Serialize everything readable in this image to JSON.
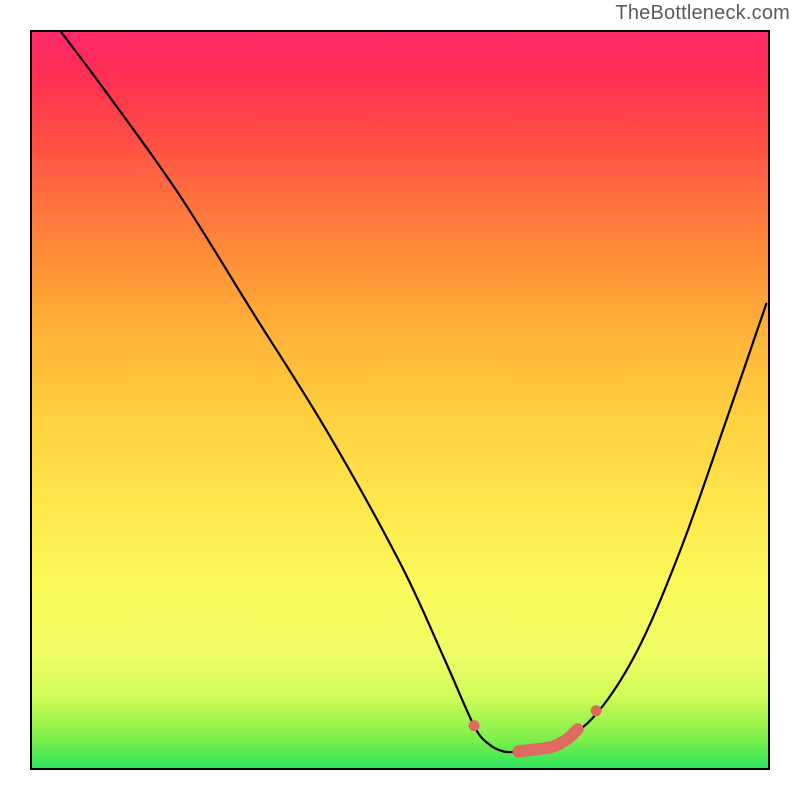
{
  "attribution": "TheBottleneck.com",
  "colors": {
    "curve": "#000000",
    "marker": "#de6a60",
    "border": "#000000"
  },
  "chart_data": {
    "type": "line",
    "title": "",
    "xlabel": "",
    "ylabel": "",
    "xlim": [
      0,
      100
    ],
    "ylim": [
      0,
      100
    ],
    "grid": false,
    "legend": false,
    "series": [
      {
        "name": "bottleneck-curve",
        "x": [
          4,
          10,
          20,
          30,
          40,
          50,
          56,
          60,
          62,
          64,
          66,
          70,
          76,
          82,
          88,
          94,
          99.5
        ],
        "y": [
          100,
          92,
          78,
          62,
          46,
          28,
          15,
          6,
          3.5,
          2.5,
          2.5,
          3,
          7,
          16,
          30,
          47,
          63
        ]
      },
      {
        "name": "optimal-range-markers",
        "type": "scatter",
        "style": "thick-rounded",
        "x": [
          60,
          66,
          70,
          70.5,
          71,
          71.5,
          72,
          72.5,
          73,
          73.5,
          74,
          76.5
        ],
        "y": [
          6,
          2.5,
          3,
          3.1,
          3.3,
          3.5,
          3.8,
          4.1,
          4.5,
          5,
          5.5,
          8
        ]
      }
    ],
    "annotations": []
  }
}
